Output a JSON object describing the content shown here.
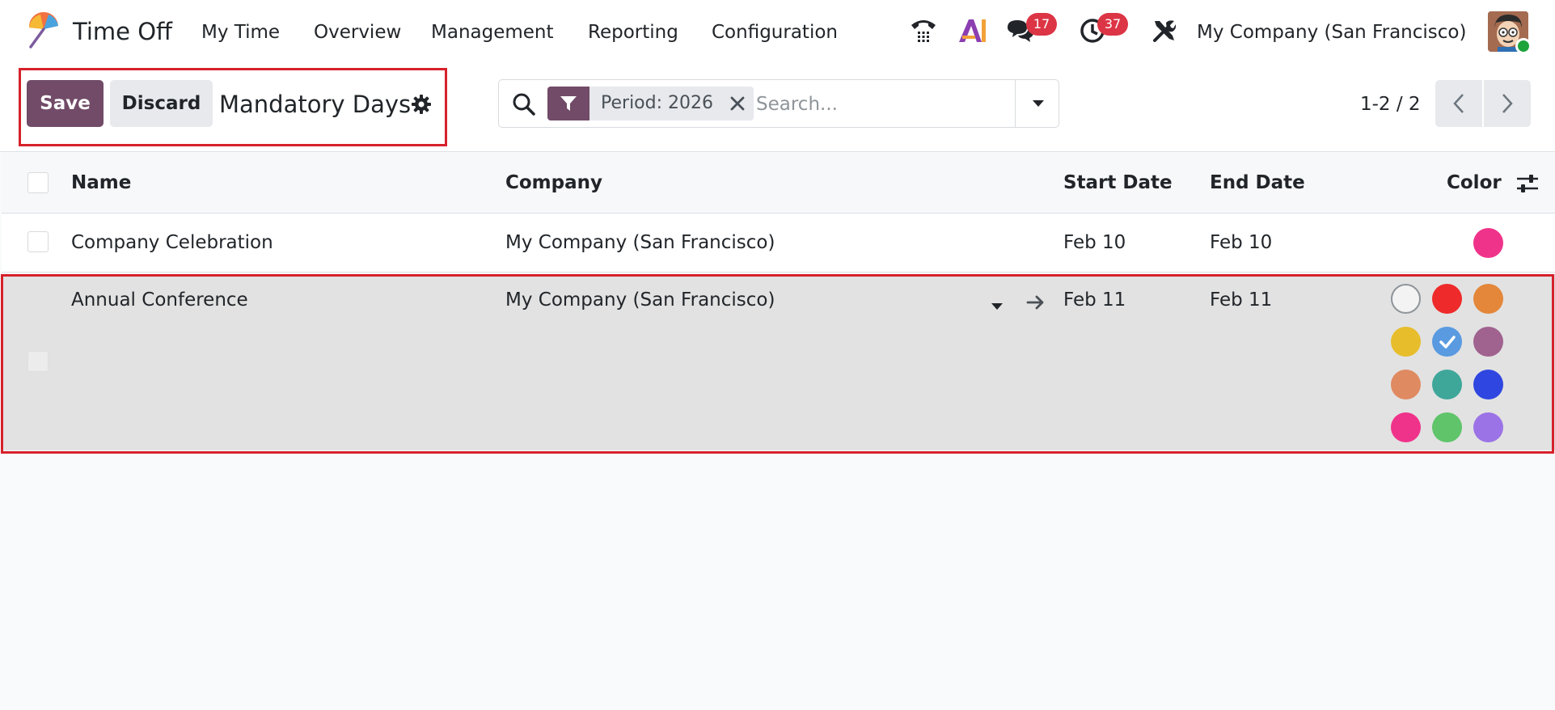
{
  "app": {
    "name": "Time Off",
    "logo_icon": "umbrella-logo-icon"
  },
  "nav": {
    "items": [
      {
        "id": "my-time",
        "label": "My Time"
      },
      {
        "id": "overview",
        "label": "Overview"
      },
      {
        "id": "management",
        "label": "Management"
      },
      {
        "id": "reporting",
        "label": "Reporting"
      },
      {
        "id": "configuration",
        "label": "Configuration"
      }
    ]
  },
  "systray": {
    "phone_icon": "phone-icon",
    "ai_icon": "ai-icon",
    "messages_icon": "chat-icon",
    "messages_count": "17",
    "activities_icon": "clock-icon",
    "activities_count": "37",
    "settings_icon": "tools-icon",
    "company": "My Company (San Francisco)"
  },
  "control_panel": {
    "save_label": "Save",
    "discard_label": "Discard",
    "title": "Mandatory Days",
    "search": {
      "facet_label": "Period: 2026",
      "placeholder": "Search..."
    },
    "pager": {
      "value": "1-2 / 2"
    }
  },
  "table": {
    "headers": {
      "name": "Name",
      "company": "Company",
      "start_date": "Start Date",
      "end_date": "End Date",
      "color": "Color"
    },
    "rows": [
      {
        "name": "Company Celebration",
        "company": "My Company (San Francisco)",
        "start_date": "Feb 10",
        "end_date": "Feb 10",
        "color": "#f0338a"
      }
    ],
    "editing_row": {
      "name": "Annual Conference",
      "company": "My Company (San Francisco)",
      "start_date": "Feb 11",
      "end_date": "Feb 11",
      "selected_color": "#5a9ae0",
      "palette": [
        "none",
        "#ef2a2a",
        "#e4873a",
        "#e7bd2b",
        "#5a9ae0",
        "#a0628f",
        "#e08a62",
        "#3fa79a",
        "#2f47e0",
        "#f0338a",
        "#5fc46a",
        "#9b73e6"
      ]
    }
  },
  "colors": {
    "brand": "#714b67",
    "highlight": "#d6212b",
    "badge": "#dc3545"
  }
}
